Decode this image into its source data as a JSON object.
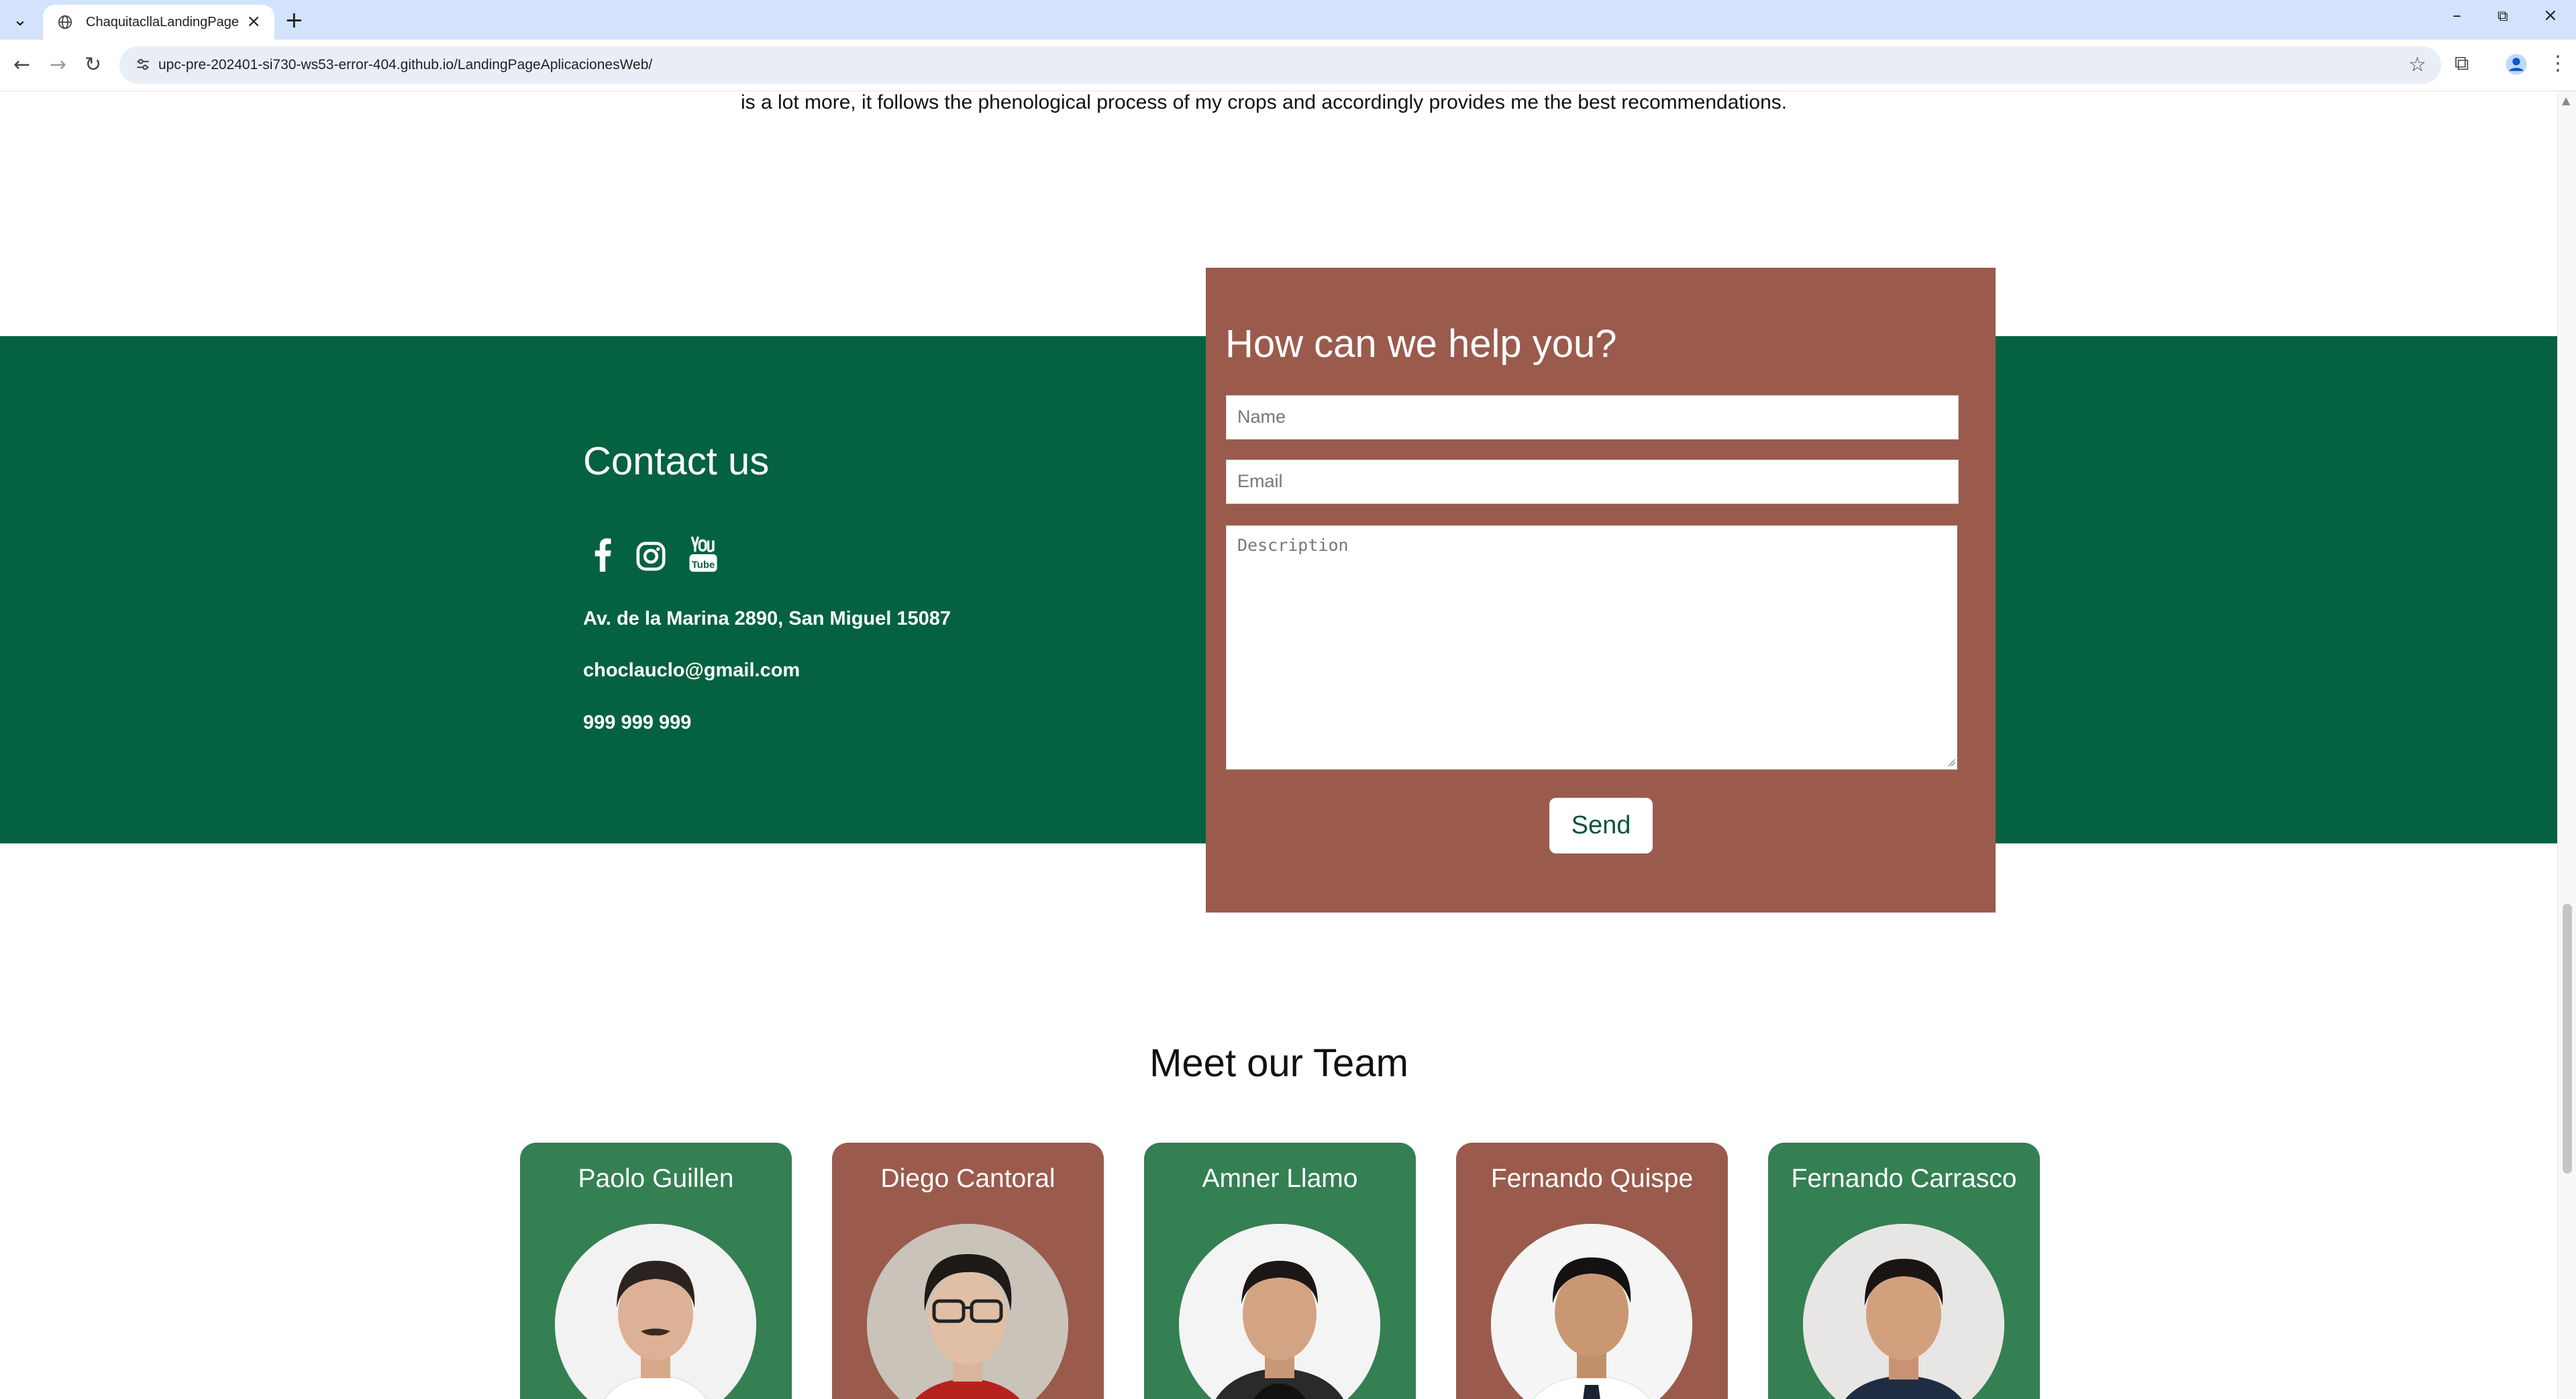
{
  "browser": {
    "tab_title": "ChaquitacllaLandingPage",
    "url": "upc-pre-202401-si730-ws53-error-404.github.io/LandingPageAplicacionesWeb/"
  },
  "testimonial": {
    "text": "is a lot more, it follows the phenological process  of my crops and accordingly provides me the best recommendations."
  },
  "contact": {
    "title": "Contact us",
    "social_icons": [
      "facebook-icon",
      "instagram-icon",
      "youtube-icon"
    ],
    "address": "Av. de la Marina 2890, San Miguel 15087",
    "email": "choclauclo@gmail.com",
    "phone": "999 999 999"
  },
  "help_form": {
    "title": "How can we help you?",
    "name_placeholder": "Name",
    "email_placeholder": "Email",
    "description_placeholder": "Description",
    "send_label": "Send"
  },
  "team": {
    "title": "Meet our Team",
    "members": [
      {
        "name": "Paolo Guillen",
        "color": "#348052"
      },
      {
        "name": "Diego Cantoral",
        "color": "#9a5b4d"
      },
      {
        "name": "Amner Llamo",
        "color": "#348052"
      },
      {
        "name": "Fernando Quispe",
        "color": "#9a5b4d"
      },
      {
        "name": "Fernando Carrasco",
        "color": "#348052"
      }
    ]
  },
  "colors": {
    "contact_band": "#046240",
    "help_box": "#9a5b4d",
    "card_green": "#348052",
    "card_brown": "#9a5b4d"
  }
}
